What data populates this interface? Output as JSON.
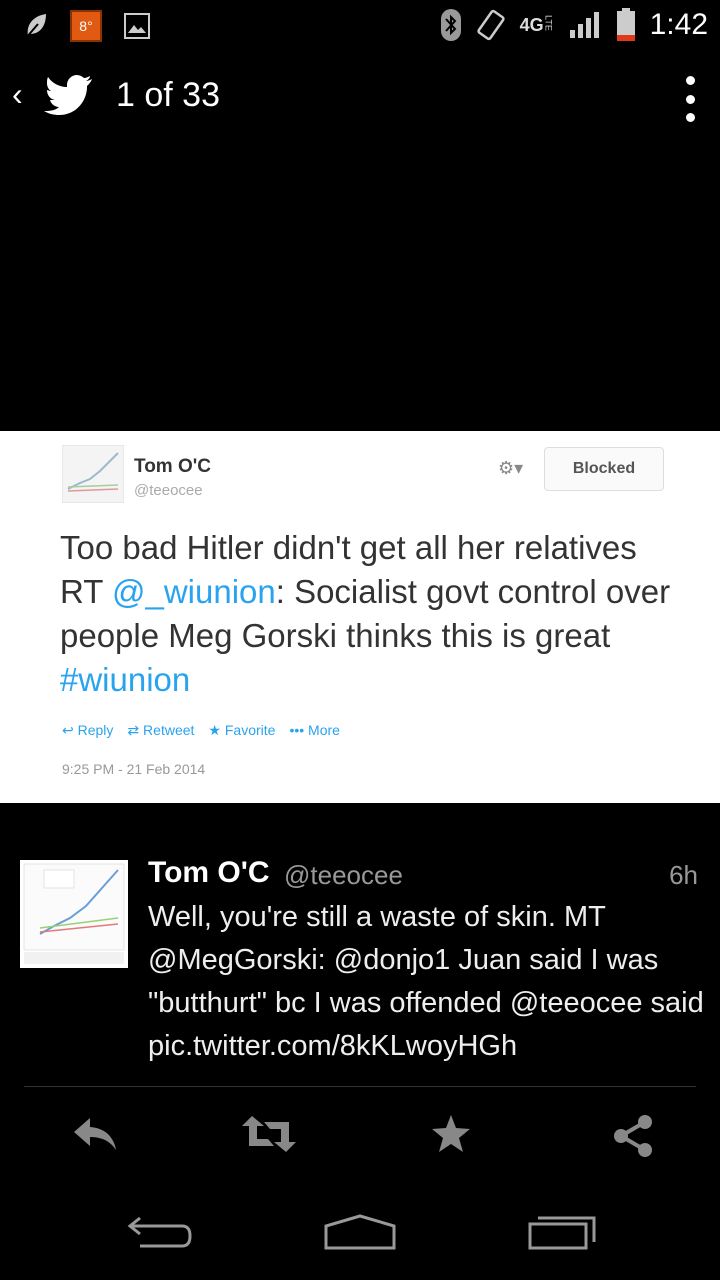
{
  "status_bar": {
    "temperature": "8°",
    "network": "4G",
    "network_sub": "LTE",
    "time": "1:42"
  },
  "action_bar": {
    "pager": "1 of 33"
  },
  "embedded_tweet": {
    "name": "Tom O'C",
    "handle": "@teeocee",
    "blocked_label": "Blocked",
    "text_part1": "Too bad Hitler didn't get all her relatives RT ",
    "mention": "@_wiunion",
    "text_part2": ": Socialist govt control over people Meg Gorski thinks this is great ",
    "hashtag": "#wiunion",
    "reply_label": "Reply",
    "retweet_label": "Retweet",
    "favorite_label": "Favorite",
    "more_label": "More",
    "date": "9:25 PM - 21 Feb 2014"
  },
  "tweet": {
    "name": "Tom O'C",
    "handle": "@teeocee",
    "time": "6h",
    "text": "Well, you're still a waste of skin. MT @MegGorski: @donjo1 Juan said I was \"butthurt\" bc I was offended @teeocee said pic.twitter.com/8kKLwoyHGh"
  },
  "colors": {
    "link": "#2aa3ef",
    "temp_badge": "#e05a14",
    "icon_gray": "#888888"
  }
}
